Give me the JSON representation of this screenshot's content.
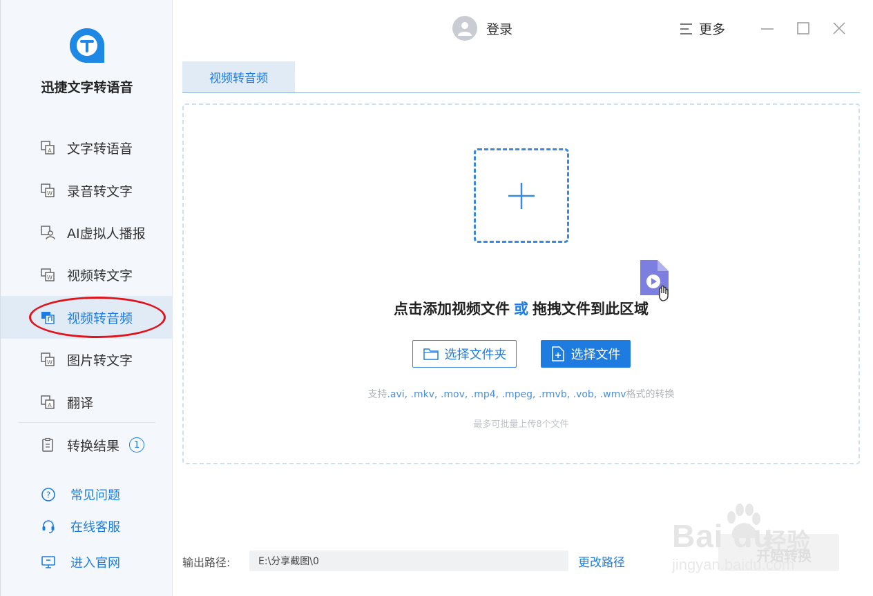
{
  "app": {
    "title": "迅捷文字转语音"
  },
  "sidebar": {
    "items": [
      {
        "label": "文字转语音",
        "icon": "text-to-speech-icon"
      },
      {
        "label": "录音转文字",
        "icon": "audio-to-text-icon"
      },
      {
        "label": "AI虚拟人播报",
        "icon": "ai-avatar-icon"
      },
      {
        "label": "视频转文字",
        "icon": "video-to-text-icon"
      },
      {
        "label": "视频转音频",
        "icon": "video-to-audio-icon",
        "active": true
      },
      {
        "label": "图片转文字",
        "icon": "image-to-text-icon"
      },
      {
        "label": "翻译",
        "icon": "translate-icon"
      }
    ],
    "results": {
      "label": "转换结果",
      "count": "1"
    },
    "links": [
      {
        "label": "常见问题",
        "icon": "question-icon"
      },
      {
        "label": "在线客服",
        "icon": "headset-icon"
      },
      {
        "label": "进入官网",
        "icon": "monitor-icon"
      }
    ]
  },
  "header": {
    "login_label": "登录",
    "more_label": "更多"
  },
  "tab": {
    "label": "视频转音频"
  },
  "dropzone": {
    "text_before": "点击添加视频文件",
    "text_or": "或",
    "text_after": "拖拽文件到此区域",
    "folder_button": "选择文件夹",
    "file_button": "选择文件",
    "formats_prefix": "支持",
    "formats_exts": ".avi, .mkv, .mov, .mp4, .mpeg, .rmvb, .vob, .wmv",
    "formats_suffix": "格式的转换",
    "limit": "最多可批量上传8个文件"
  },
  "output": {
    "label": "输出路径:",
    "path": "E:\\分享截图\\0",
    "change_label": "更改路径"
  },
  "watermark": {
    "brand": "Bai  du",
    "jingyan_cn": "经验",
    "jingyan_url": "jingyan.baidu.com",
    "box_text": "开始转换"
  },
  "colors": {
    "accent": "#1e7ce0",
    "sidebar_bg": "#f4f8fc",
    "active_bg": "#e1ebf6",
    "annotation": "#e0141c"
  }
}
